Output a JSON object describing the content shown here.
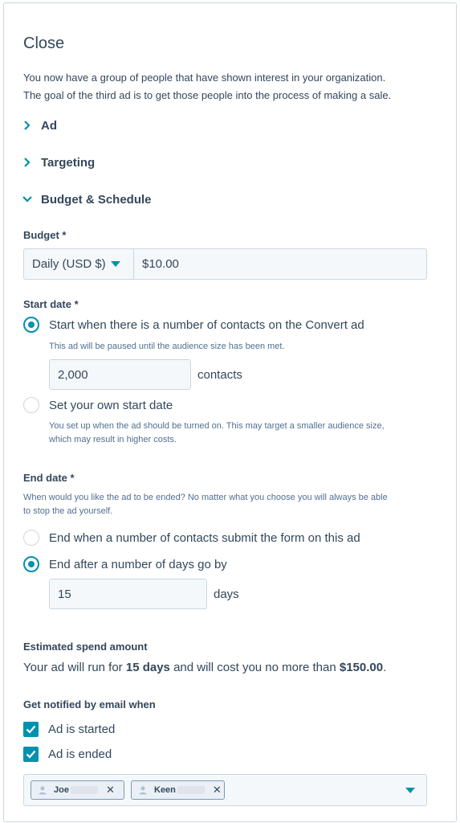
{
  "header": {
    "title": "Close",
    "intro_line1": "You now have a group of people that have shown interest in your organization.",
    "intro_line2": "The goal of the third ad is to get those people into the process of making a sale."
  },
  "sections": [
    {
      "label": "Ad",
      "expanded": false,
      "icon": "chevron-right-icon"
    },
    {
      "label": "Targeting",
      "expanded": false,
      "icon": "chevron-right-icon"
    },
    {
      "label": "Budget & Schedule",
      "expanded": true,
      "icon": "chevron-down-icon"
    }
  ],
  "budget": {
    "label": "Budget *",
    "period_selected": "Daily (USD $)",
    "amount": "$10.00"
  },
  "start_date": {
    "label": "Start date *",
    "option1_label": "Start when there is a number of contacts on the Convert ad",
    "option1_help": "This ad will be paused until the audience size has been met.",
    "option1_checked": true,
    "contacts_value": "2,000",
    "contacts_suffix": "contacts",
    "option2_label": "Set your own start date",
    "option2_help_line1": "You set up when the ad should be turned on. This may target a smaller audience size,",
    "option2_help_line2": "which may result in higher costs.",
    "option2_checked": false
  },
  "end_date": {
    "label": "End date *",
    "help_line1": "When would you like the ad to be ended? No matter what you choose you will always be able",
    "help_line2": "to stop the ad yourself.",
    "option1_label": "End when a number of contacts submit the form on this ad",
    "option1_checked": false,
    "option2_label": "End after a number of days go by",
    "option2_checked": true,
    "days_value": "15",
    "days_suffix": "days"
  },
  "estimate": {
    "label": "Estimated spend amount",
    "text_prefix": "Your ad will run for ",
    "days_bold": "15 days",
    "text_mid": " and will cost you no more than ",
    "amount_bold": "$150.00",
    "text_suffix": "."
  },
  "notifications": {
    "label": "Get notified by email when",
    "checkbox1_label": "Ad is started",
    "checkbox1_checked": true,
    "checkbox2_label": "Ad is ended",
    "checkbox2_checked": true,
    "recipients": [
      {
        "name": "Joe"
      },
      {
        "name": "Keen"
      }
    ],
    "remove_glyph": "✕"
  },
  "colors": {
    "accent": "#0091ae",
    "text": "#33475b",
    "border": "#cbd6e2",
    "input_bg": "#f5f8fa"
  }
}
